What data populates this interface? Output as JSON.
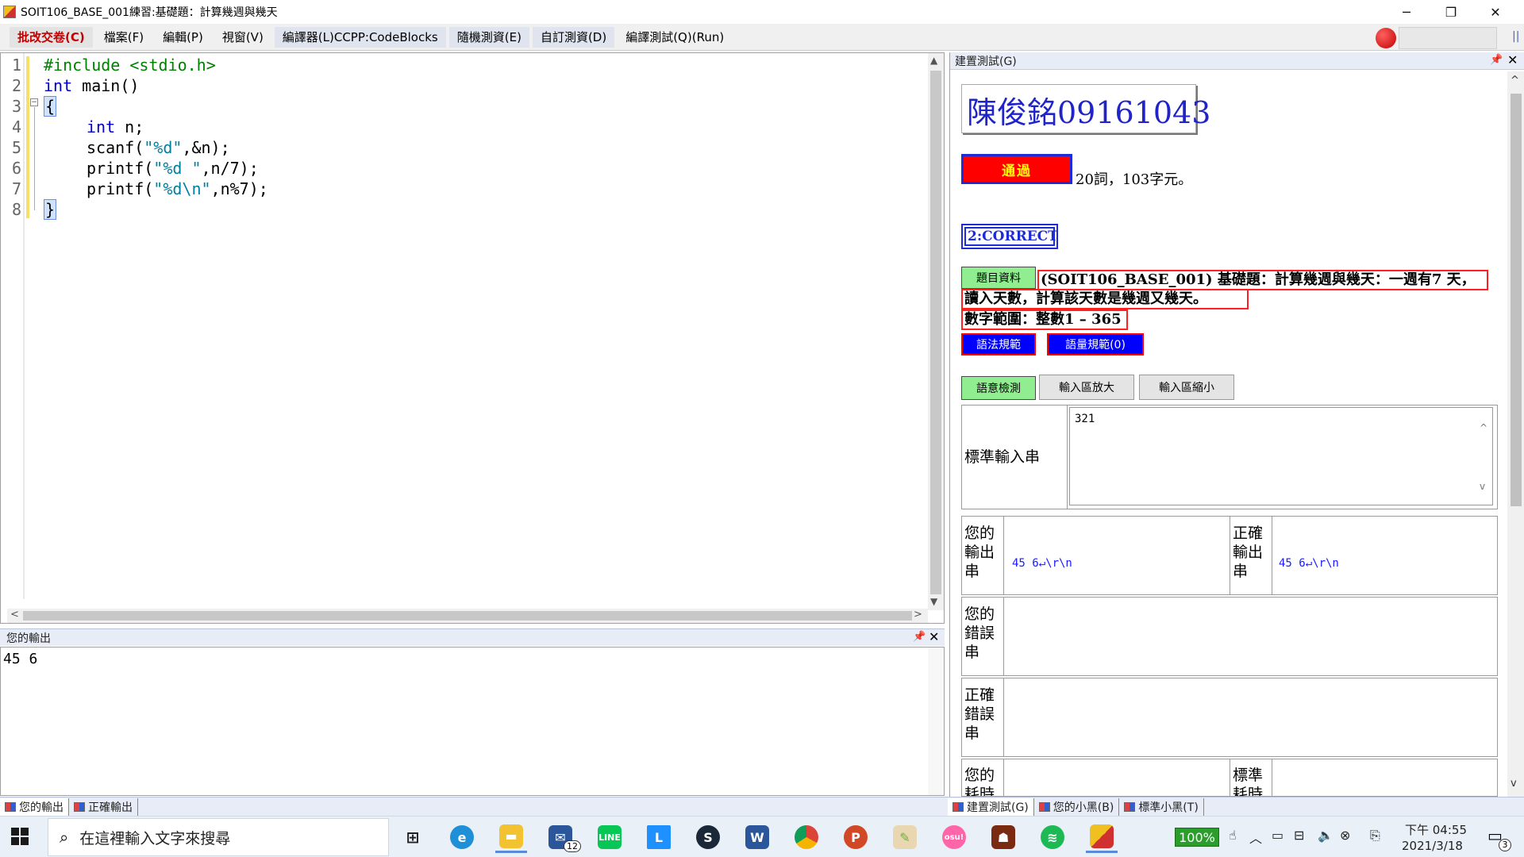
{
  "window": {
    "title": "SOIT106_BASE_001練習:基礎題：計算幾週與幾天",
    "minimize": "─",
    "maximize": "❐",
    "close": "✕"
  },
  "menu": [
    "批改交卷(C)",
    "檔案(F)",
    "編輯(P)",
    "視窗(V)",
    "編譯器(L)CCPP:CodeBlocks",
    "隨機測資(E)",
    "自訂測資(D)",
    "編譯測試(Q)(Run)"
  ],
  "menu_grip": "||",
  "editor": {
    "line_numbers": [
      "1",
      "2",
      "3",
      "4",
      "5",
      "6",
      "7",
      "8"
    ],
    "scroll_up": "▲",
    "scroll_down": "▼",
    "scroll_left": "<",
    "scroll_right": ">",
    "fold_marker": "−"
  },
  "code": {
    "l1_pp": "#include",
    "l1_rest": " <stdio.h>",
    "l2_kw": "int",
    "l2_rest": " main()",
    "l3": "{",
    "l4_kw": "int",
    "l4_rest": " n;",
    "l5_a": "scanf(",
    "l5_s": "\"%d\"",
    "l5_b": ",&n);",
    "l6_a": "printf(",
    "l6_s": "\"%d \"",
    "l6_b": ",n/7);",
    "l7_a": "printf(",
    "l7_s": "\"%d\\n\"",
    "l7_b": ",n%7);",
    "l8": "}"
  },
  "output_panel": {
    "title": "您的輸出",
    "text": "45 6",
    "pin": "📌",
    "close": "✕"
  },
  "bottom_tabs": [
    "您的輸出",
    "正確輸出"
  ],
  "right_panel": {
    "title": "建置測試(G)",
    "pin": "📌",
    "close": "✕",
    "student": "陳俊銘09161043",
    "pass": "通過",
    "stats": "20詞，103字元。",
    "result": "2:CORRECT",
    "problem_btn": "題目資料",
    "problem_line1": "(SOIT106_BASE_001) 基礎題：計算幾週與幾天：一週有7 天，",
    "problem_line2": "讀入天數，計算該天數是幾週又幾天。",
    "problem_line3": "數字範圍：整數1 – 365",
    "syntax_btn": "語法規範",
    "quantity_btn": "語量規範(0)",
    "semantic_btn": "語意檢測",
    "enlarge_btn": "輸入區放大",
    "shrink_btn": "輸入區縮小",
    "stdin_label": "標準輸入串",
    "stdin_value": "321",
    "your_output_label": "您的輸出串",
    "your_output_value": "45 6↵\\r\\n",
    "correct_output_label": "正確輸出串",
    "correct_output_value": "45 6↵\\r\\n",
    "your_error_label": "您的錯誤串",
    "correct_error_label": "正確錯誤串",
    "your_time_label": "您的耗時",
    "std_time_label": "標準耗時",
    "scroll_up": "^",
    "scroll_down": "v"
  },
  "right_tabs": [
    "建置測試(G)",
    "您的小黑(B)",
    "標準小黑(T)"
  ],
  "taskbar": {
    "search_placeholder": "在這裡輸入文字來搜尋",
    "mail_badge": "12",
    "battery": "100%",
    "time": "下午 04:55",
    "date": "2021/3/18",
    "notification_count": "3"
  }
}
